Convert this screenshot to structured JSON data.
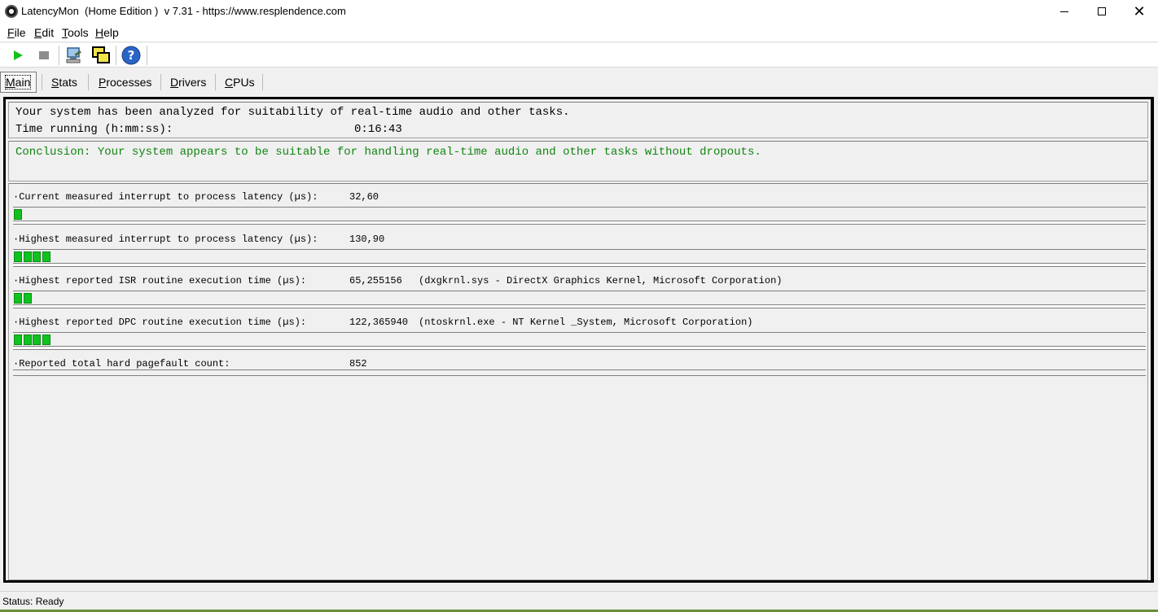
{
  "window": {
    "title": "LatencyMon  (Home Edition )  v 7.31 - https://www.resplendence.com",
    "controls": [
      "minimize",
      "maximize",
      "close"
    ]
  },
  "menu": [
    "File",
    "Edit",
    "Tools",
    "Help"
  ],
  "toolbar": {
    "buttons": [
      "play-icon",
      "stop-icon",
      "computer-tools-icon",
      "windows-icon",
      "help-icon"
    ],
    "colors": {
      "play": "#16c01a",
      "stop": "#8c8c8c"
    }
  },
  "tabs": [
    "Main",
    "Stats",
    "Processes",
    "Drivers",
    "CPUs"
  ],
  "main": {
    "analysis_text": "Your system has been analyzed for suitability of real-time audio and other tasks.",
    "time_label": "Time running (h:mm:ss):",
    "time_value": "0:16:43",
    "conclusion": "Conclusion: Your system appears to be suitable for handling real-time audio and other tasks without dropouts.",
    "conclusion_color": "#118411",
    "metrics": [
      {
        "label": "·Current measured interrupt to process latency (µs):",
        "value": "32,60",
        "detail": "",
        "bar_segments": 1
      },
      {
        "label": "·Highest measured interrupt to process latency (µs):",
        "value": "130,90",
        "detail": "",
        "bar_segments": 4
      },
      {
        "label": "·Highest reported ISR routine execution time (µs):",
        "value": "65,255156",
        "detail": "(dxgkrnl.sys - DirectX Graphics Kernel, Microsoft Corporation)",
        "bar_segments": 2
      },
      {
        "label": "·Highest reported DPC routine execution time (µs):",
        "value": "122,365940",
        "detail": "(ntoskrnl.exe - NT Kernel _System, Microsoft Corporation)",
        "bar_segments": 4
      },
      {
        "label": "·Reported total hard pagefault count:",
        "value": "852",
        "detail": "",
        "bar_segments": 0
      }
    ],
    "bar_color": "#0fc31f"
  },
  "status": {
    "text": "Status: Ready"
  }
}
